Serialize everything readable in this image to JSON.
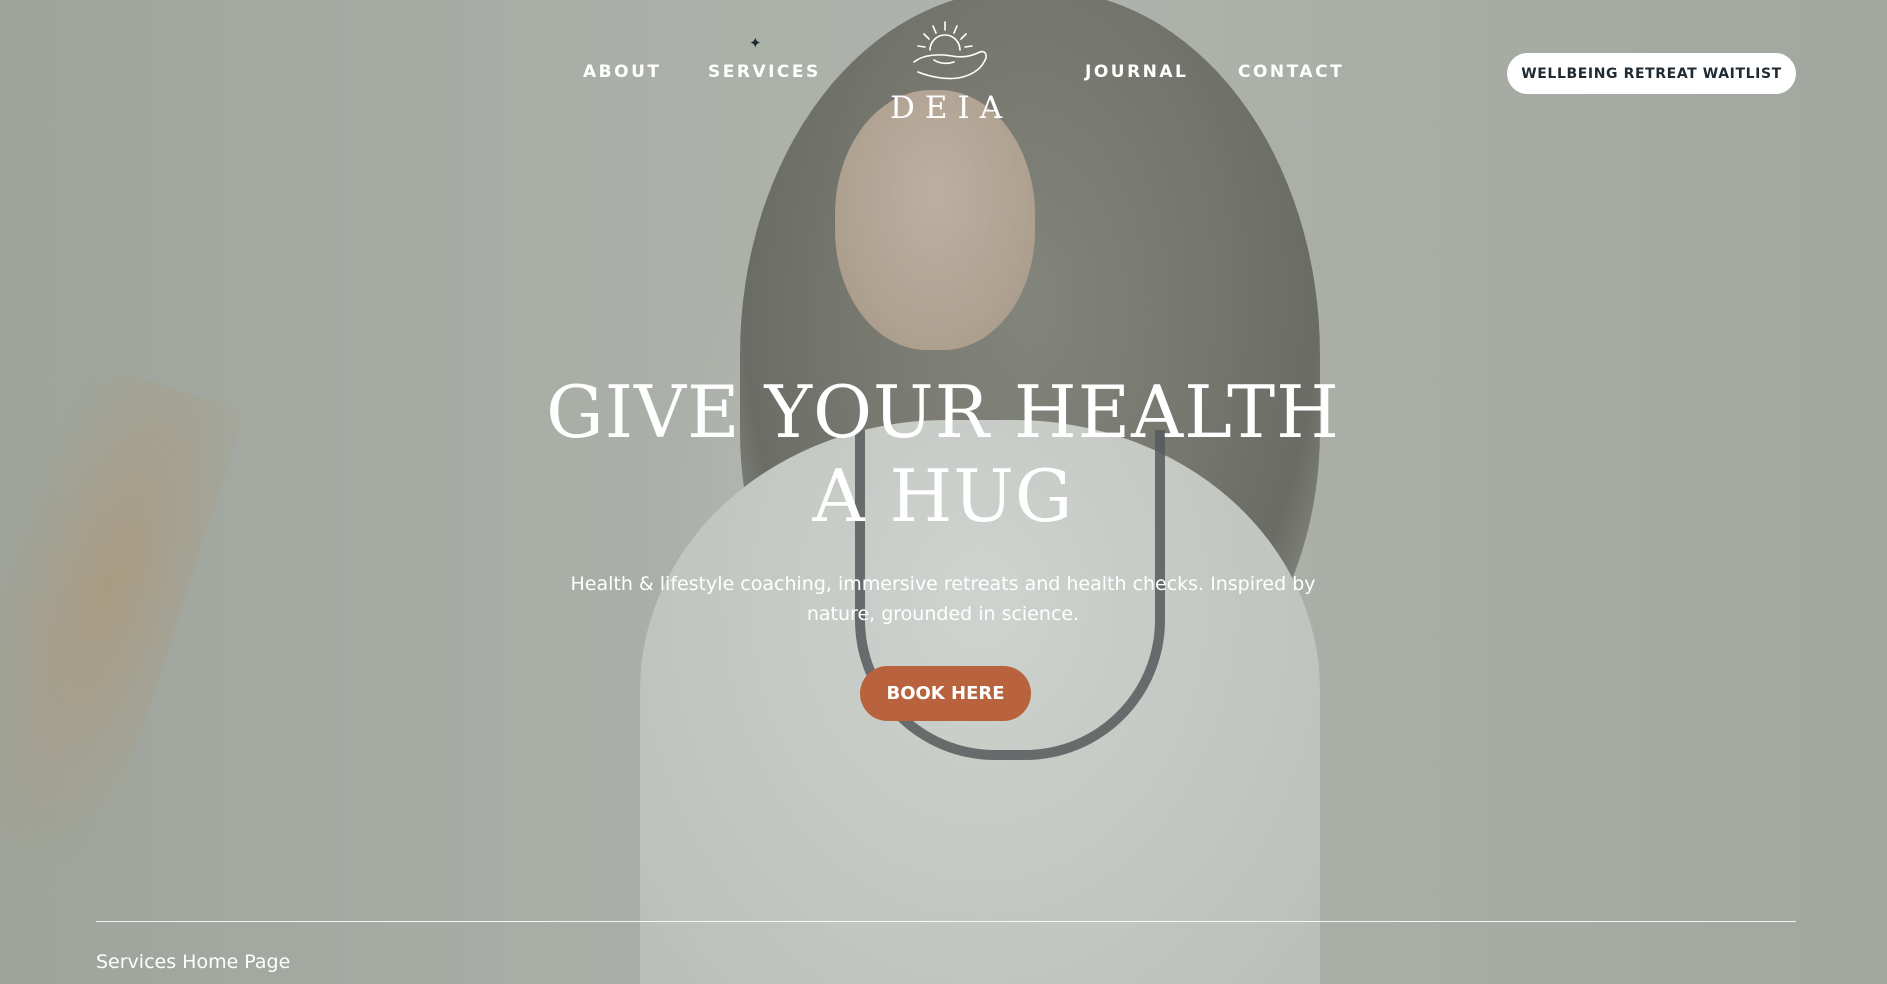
{
  "nav": {
    "items": [
      {
        "label": "ABOUT"
      },
      {
        "label": "SERVICES"
      },
      {
        "label": "JOURNAL"
      },
      {
        "label": "CONTACT"
      }
    ],
    "active_marker_icon": "sparkle-icon"
  },
  "logo": {
    "text": "DEIA",
    "icon": "sunrise-hand-icon"
  },
  "header": {
    "waitlist_button": "WELLBEING RETREAT WAITLIST"
  },
  "hero": {
    "heading_line1": "GIVE YOUR HEALTH",
    "heading_line2": "A HUG",
    "subtitle": "Health & lifestyle coaching, immersive retreats and health checks. Inspired by nature, grounded in science.",
    "cta_label": "BOOK HERE"
  },
  "footer": {
    "label": "Services Home Page"
  },
  "colors": {
    "cta": "#b8633d",
    "text": "#ffffff",
    "dark": "#1f2a33"
  }
}
